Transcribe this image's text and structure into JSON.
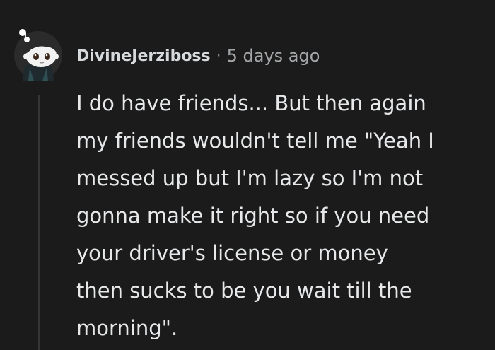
{
  "comment": {
    "username": "DivineJerziboss",
    "separator": "·",
    "timestamp": "5 days ago",
    "avatar_icon": "reddit-snoo-avatar-icon",
    "body_lines": [
      "I do have friends... But then again",
      "my friends wouldn't tell me \"Yeah I",
      "messed up but I'm lazy so I'm not",
      "gonna make it right so if you need",
      "your driver's license or money",
      "then sucks to be you wait till the",
      "morning\"."
    ]
  },
  "colors": {
    "background": "#1b1b1b",
    "text": "#d7dadc",
    "meta": "#a5a8aa",
    "thread_line": "#343536"
  }
}
